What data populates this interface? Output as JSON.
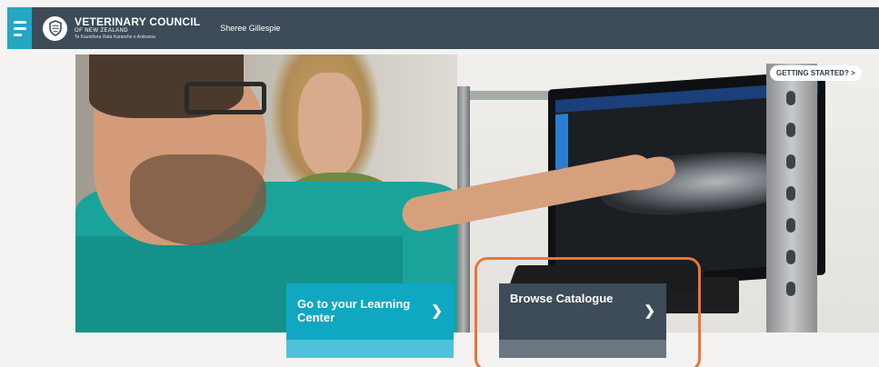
{
  "header": {
    "org_title": "VETERINARY COUNCIL",
    "org_sub": "OF NEW ZEALAND",
    "org_maori": "Te Kaunihera Rata Kararehe o Aotearoa",
    "user_name": "Sheree Gillespie"
  },
  "hero": {
    "getting_started": "GETTING STARTED? >"
  },
  "tiles": {
    "learning_center": "Go to your Learning Center",
    "browse_catalogue": "Browse Catalogue"
  },
  "colors": {
    "topbar": "#3d4b58",
    "accent_teal": "#10a7c3",
    "tile_dark": "#3e4b58",
    "highlight": "#e8753a"
  }
}
